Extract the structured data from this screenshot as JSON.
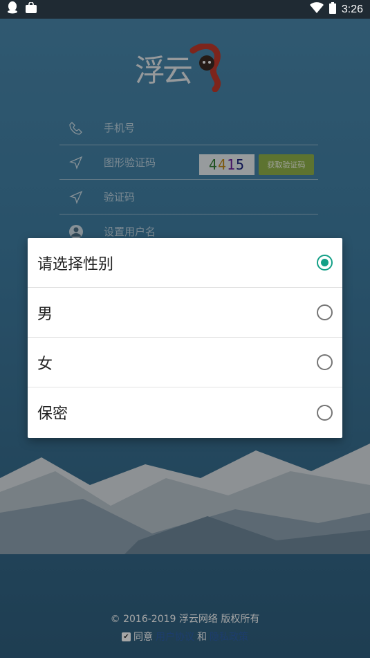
{
  "status_bar": {
    "time": "3:26",
    "icons": [
      "qq-icon",
      "bag-icon",
      "wifi-icon",
      "battery-icon"
    ]
  },
  "logo": {
    "text": "浮云"
  },
  "form": {
    "phone_placeholder": "手机号",
    "captcha_placeholder": "图形验证码",
    "captcha_image_text": [
      "4",
      "4",
      "1",
      "5"
    ],
    "get_code_button": "获取验证码",
    "code_placeholder": "验证码",
    "username_placeholder": "设置用户名"
  },
  "dialog": {
    "title": "请选择性别",
    "options": [
      {
        "label": "男",
        "selected": false
      },
      {
        "label": "女",
        "selected": false
      },
      {
        "label": "保密",
        "selected": false
      }
    ],
    "title_selected": true,
    "accent_color": "#14a087"
  },
  "footer": {
    "copyright": "© 2016-2019 浮云网络 版权所有",
    "agree_prefix": "同意",
    "user_agreement": "用户协议",
    "and": "和",
    "privacy_policy": "隐私政策",
    "checked": true
  },
  "colors": {
    "link": "#2d5fa8",
    "get_code_bg": "#8fb14a"
  }
}
